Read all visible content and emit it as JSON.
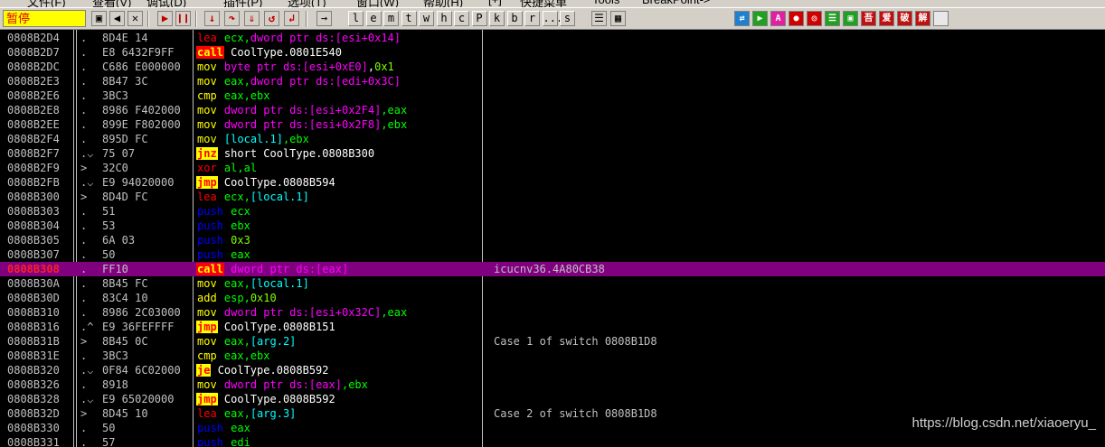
{
  "menubar": {
    "items": [
      "文件(F)",
      "查看(V)",
      "调试(D)",
      "插件(P)",
      "选项(T)",
      "窗口(W)",
      "帮助(H)",
      "[+]",
      "快捷菜单",
      "Tools",
      "BreakPoint->"
    ]
  },
  "toolbar": {
    "status": "暂停",
    "letters": [
      "l",
      "e",
      "m",
      "t",
      "w",
      "h",
      "c",
      "P",
      "k",
      "b",
      "r",
      "...",
      "s"
    ],
    "right_icons": [
      "吾",
      "爱",
      "破",
      "解"
    ]
  },
  "colors": {
    "background": "#000000",
    "selected_row": "#800080",
    "selected_address": "#ff2020",
    "call_bg": "#ff0000",
    "jump_bg": "#ffff00",
    "push_text": "#0000ff",
    "register_text": "#00ff00",
    "memory_text": "#ff00ff"
  },
  "disasm": {
    "rows": [
      {
        "addr": "0808B2D4",
        "mark": ".",
        "hex": "8D4E 14",
        "mn": "lea",
        "ops": [
          [
            "reg",
            "ecx,"
          ],
          [
            "mem",
            "dword ptr ds:[esi+0x14]"
          ]
        ],
        "comment": ""
      },
      {
        "addr": "0808B2D7",
        "mark": ".",
        "hex": "E8 6432F9FF",
        "mn": "call",
        "ops": [
          [
            "txt",
            "CoolType.0801E540"
          ]
        ],
        "comment": ""
      },
      {
        "addr": "0808B2DC",
        "mark": ".",
        "hex": "C686 E000000",
        "mn": "mov",
        "ops": [
          [
            "mem",
            "byte ptr ds:[esi+0xE0]"
          ],
          [
            "txt",
            ","
          ],
          [
            "imm",
            "0x1"
          ]
        ],
        "comment": ""
      },
      {
        "addr": "0808B2E3",
        "mark": ".",
        "hex": "8B47 3C",
        "mn": "mov",
        "ops": [
          [
            "reg",
            "eax,"
          ],
          [
            "mem",
            "dword ptr ds:[edi+0x3C]"
          ]
        ],
        "comment": ""
      },
      {
        "addr": "0808B2E6",
        "mark": ".",
        "hex": "3BC3",
        "mn": "cmp",
        "ops": [
          [
            "reg",
            "eax,ebx"
          ]
        ],
        "comment": ""
      },
      {
        "addr": "0808B2E8",
        "mark": ".",
        "hex": "8986 F402000",
        "mn": "mov",
        "ops": [
          [
            "mem",
            "dword ptr ds:[esi+0x2F4]"
          ],
          [
            "reg",
            ",eax"
          ]
        ],
        "comment": ""
      },
      {
        "addr": "0808B2EE",
        "mark": ".",
        "hex": "899E F802000",
        "mn": "mov",
        "ops": [
          [
            "mem",
            "dword ptr ds:[esi+0x2F8]"
          ],
          [
            "reg",
            ",ebx"
          ]
        ],
        "comment": ""
      },
      {
        "addr": "0808B2F4",
        "mark": ".",
        "hex": "895D FC",
        "mn": "mov",
        "ops": [
          [
            "local",
            "[local.1]"
          ],
          [
            "reg",
            ",ebx"
          ]
        ],
        "comment": ""
      },
      {
        "addr": "0808B2F7",
        "mark": ".⌵",
        "hex": "75 07",
        "mn": "jnz",
        "ops": [
          [
            "txt",
            "short CoolType.0808B300"
          ]
        ],
        "comment": ""
      },
      {
        "addr": "0808B2F9",
        "mark": ">",
        "hex": "32C0",
        "mn": "xor",
        "ops": [
          [
            "reg",
            "al,al"
          ]
        ],
        "comment": ""
      },
      {
        "addr": "0808B2FB",
        "mark": ".⌵",
        "hex": "E9 94020000",
        "mn": "jmp",
        "ops": [
          [
            "txt",
            "CoolType.0808B594"
          ]
        ],
        "comment": ""
      },
      {
        "addr": "0808B300",
        "mark": ">",
        "hex": "8D4D FC",
        "mn": "lea",
        "ops": [
          [
            "reg",
            "ecx,"
          ],
          [
            "local",
            "[local.1]"
          ]
        ],
        "comment": ""
      },
      {
        "addr": "0808B303",
        "mark": ".",
        "hex": "51",
        "mn": "push",
        "ops": [
          [
            "reg",
            "ecx"
          ]
        ],
        "comment": ""
      },
      {
        "addr": "0808B304",
        "mark": ".",
        "hex": "53",
        "mn": "push",
        "ops": [
          [
            "reg",
            "ebx"
          ]
        ],
        "comment": ""
      },
      {
        "addr": "0808B305",
        "mark": ".",
        "hex": "6A 03",
        "mn": "push",
        "ops": [
          [
            "imm",
            "0x3"
          ]
        ],
        "comment": ""
      },
      {
        "addr": "0808B307",
        "mark": ".",
        "hex": "50",
        "mn": "push",
        "ops": [
          [
            "reg",
            "eax"
          ]
        ],
        "comment": ""
      },
      {
        "addr": "0808B308",
        "mark": ".",
        "hex": "FF10",
        "mn": "call",
        "ops": [
          [
            "mem",
            "dword ptr ds:[eax]"
          ]
        ],
        "comment": "icucnv36.4A80CB38",
        "selected": true
      },
      {
        "addr": "0808B30A",
        "mark": ".",
        "hex": "8B45 FC",
        "mn": "mov",
        "ops": [
          [
            "reg",
            "eax,"
          ],
          [
            "local",
            "[local.1]"
          ]
        ],
        "comment": ""
      },
      {
        "addr": "0808B30D",
        "mark": ".",
        "hex": "83C4 10",
        "mn": "add",
        "ops": [
          [
            "reg",
            "esp,"
          ],
          [
            "imm",
            "0x10"
          ]
        ],
        "comment": ""
      },
      {
        "addr": "0808B310",
        "mark": ".",
        "hex": "8986 2C03000",
        "mn": "mov",
        "ops": [
          [
            "mem",
            "dword ptr ds:[esi+0x32C]"
          ],
          [
            "reg",
            ",eax"
          ]
        ],
        "comment": ""
      },
      {
        "addr": "0808B316",
        "mark": ".^",
        "hex": "E9 36FEFFFF",
        "mn": "jmp",
        "ops": [
          [
            "txt",
            "CoolType.0808B151"
          ]
        ],
        "comment": ""
      },
      {
        "addr": "0808B31B",
        "mark": ">",
        "hex": "8B45 0C",
        "mn": "mov",
        "ops": [
          [
            "reg",
            "eax,"
          ],
          [
            "local",
            "[arg.2]"
          ]
        ],
        "comment": "Case 1 of switch 0808B1D8"
      },
      {
        "addr": "0808B31E",
        "mark": ".",
        "hex": "3BC3",
        "mn": "cmp",
        "ops": [
          [
            "reg",
            "eax,ebx"
          ]
        ],
        "comment": ""
      },
      {
        "addr": "0808B320",
        "mark": ".⌵",
        "hex": "0F84 6C02000",
        "mn": "je",
        "ops": [
          [
            "txt",
            "CoolType.0808B592"
          ]
        ],
        "comment": ""
      },
      {
        "addr": "0808B326",
        "mark": ".",
        "hex": "8918",
        "mn": "mov",
        "ops": [
          [
            "mem",
            "dword ptr ds:[eax]"
          ],
          [
            "reg",
            ",ebx"
          ]
        ],
        "comment": ""
      },
      {
        "addr": "0808B328",
        "mark": ".⌵",
        "hex": "E9 65020000",
        "mn": "jmp",
        "ops": [
          [
            "txt",
            "CoolType.0808B592"
          ]
        ],
        "comment": ""
      },
      {
        "addr": "0808B32D",
        "mark": ">",
        "hex": "8D45 10",
        "mn": "lea",
        "ops": [
          [
            "reg",
            "eax,"
          ],
          [
            "local",
            "[arg.3]"
          ]
        ],
        "comment": "Case 2 of switch 0808B1D8"
      },
      {
        "addr": "0808B330",
        "mark": ".",
        "hex": "50",
        "mn": "push",
        "ops": [
          [
            "reg",
            "eax"
          ]
        ],
        "comment": ""
      },
      {
        "addr": "0808B331",
        "mark": ".",
        "hex": "57",
        "mn": "push",
        "ops": [
          [
            "reg",
            "edi"
          ]
        ],
        "comment": ""
      }
    ]
  },
  "watermark": "https://blog.csdn.net/xiaoeryu_"
}
